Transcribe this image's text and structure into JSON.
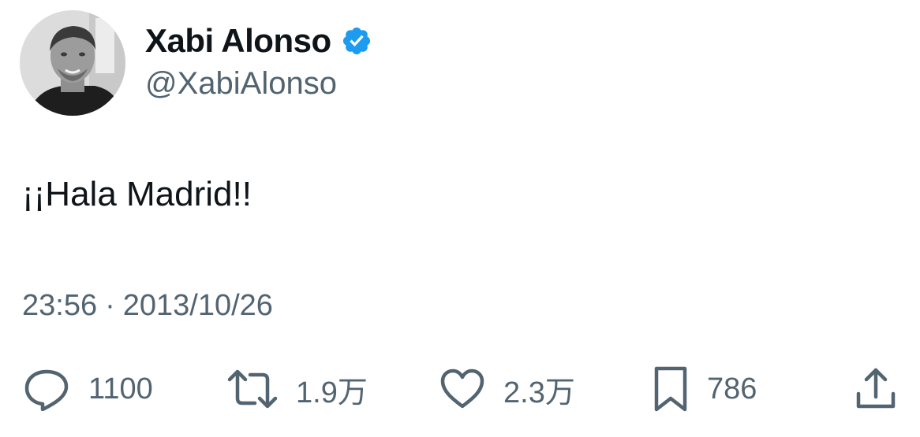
{
  "tweet": {
    "author": {
      "display_name": "Xabi Alonso",
      "handle": "@XabiAlonso",
      "verified": true,
      "verified_color": "#1d9bf0"
    },
    "text": "¡¡Hala Madrid!!",
    "time": "23:56",
    "separator": "·",
    "date": "2013/10/26",
    "actions": {
      "reply": {
        "icon": "reply-icon",
        "count": "1100"
      },
      "retweet": {
        "icon": "retweet-icon",
        "count": "1.9万"
      },
      "like": {
        "icon": "heart-icon",
        "count": "2.3万"
      },
      "bookmark": {
        "icon": "bookmark-icon",
        "count": "786"
      },
      "share": {
        "icon": "share-icon"
      }
    }
  },
  "colors": {
    "primary_text": "#0f1419",
    "secondary_text": "#536471",
    "background": "#ffffff"
  }
}
